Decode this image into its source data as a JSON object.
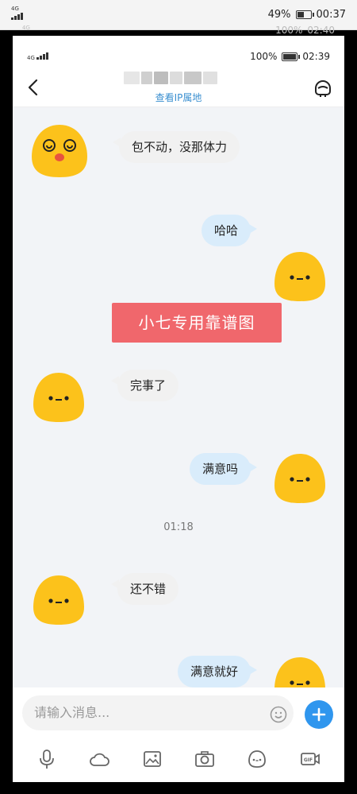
{
  "outer_status": {
    "network": "4G",
    "battery": "49%",
    "time": "00:37"
  },
  "ghost_status": {
    "network": "4G",
    "battery": "100%",
    "time": "02:40"
  },
  "inner_status": {
    "network": "4G",
    "battery": "100%",
    "time": "02:39"
  },
  "header": {
    "ip_link": "查看IP属地"
  },
  "messages": [
    {
      "side": "left",
      "text": "包不动，没那体力"
    },
    {
      "side": "right",
      "text": "哈哈"
    },
    {
      "side": "left",
      "text": "完事了"
    },
    {
      "side": "right",
      "text": "满意吗"
    },
    {
      "side": "left",
      "text": "还不错"
    },
    {
      "side": "right",
      "text": "满意就好"
    }
  ],
  "timestamp": "01:18",
  "watermark": "小七专用靠谱图",
  "input": {
    "placeholder": "请输入消息..."
  },
  "toolbar": [
    "voice-icon",
    "cloud-icon",
    "image-icon",
    "camera-icon",
    "emoji-icon",
    "gif-icon"
  ],
  "colors": {
    "accent": "#2f96ee",
    "link": "#3a8fd0",
    "watermark_bg": "#f0676c",
    "bubble_right": "#d9ecfb",
    "bubble_left": "#f1f1f1",
    "avatar": "#fcc21b"
  }
}
